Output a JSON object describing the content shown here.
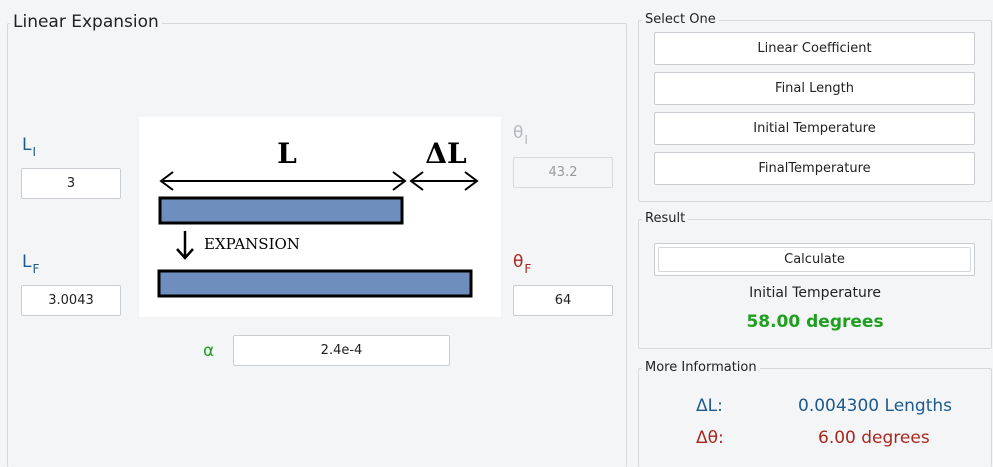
{
  "panel": {
    "title": "Linear Expansion",
    "diagram": {
      "length_label": "L",
      "delta_label": "ΔL",
      "expansion_label": "EXPANSION"
    },
    "length_initial": {
      "symbol": "L",
      "sub": "I",
      "value": "3"
    },
    "length_final": {
      "symbol": "L",
      "sub": "F",
      "value": "3.0043"
    },
    "theta_initial": {
      "symbol": "θ",
      "sub": "I",
      "value": "43.2"
    },
    "theta_final": {
      "symbol": "θ",
      "sub": "F",
      "value": "64"
    },
    "alpha": {
      "symbol": "α",
      "value": "2.4e-4"
    }
  },
  "select": {
    "title": "Select One",
    "options": [
      "Linear Coefficient",
      "Final Length",
      "Initial Temperature",
      "FinalTemperature"
    ]
  },
  "result": {
    "title": "Result",
    "calculate_label": "Calculate",
    "quantity": "Initial Temperature",
    "value": "58.00 degrees"
  },
  "info": {
    "title": "More Information",
    "rows": [
      {
        "label": "ΔL:",
        "value": "0.004300 Lengths"
      },
      {
        "label": "Δθ:",
        "value": "6.00 degrees"
      }
    ]
  },
  "colors": {
    "blue": "#1e5a8c",
    "red": "#a8281e",
    "green": "#1f9f1f",
    "bar": "#6e8fbe"
  }
}
